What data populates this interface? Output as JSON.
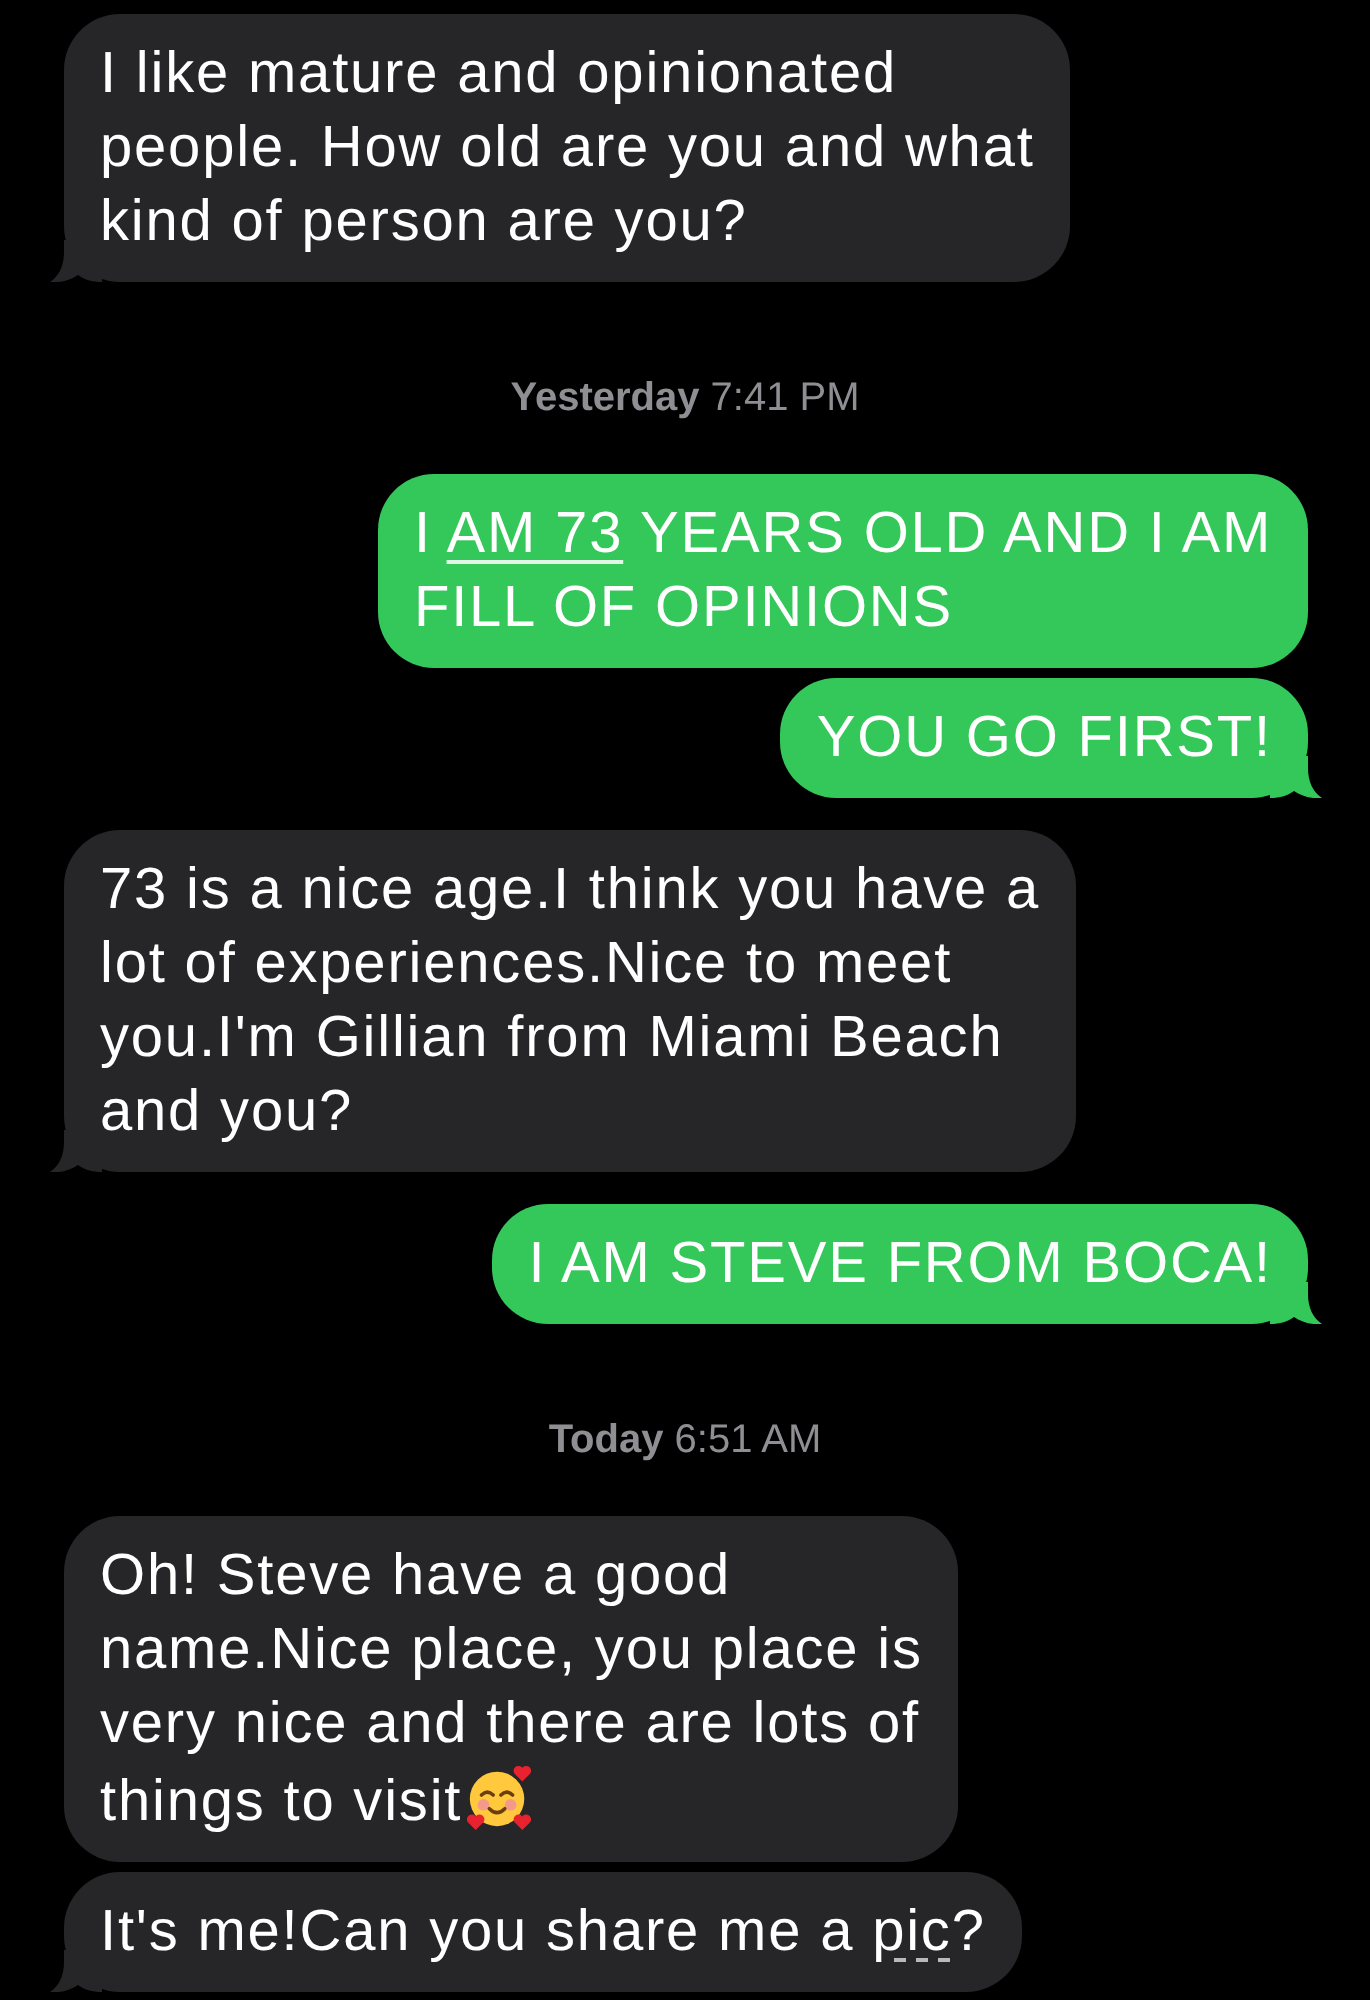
{
  "thread": [
    {
      "kind": "received",
      "tail": true,
      "lines": [
        [
          {
            "kind": "text",
            "text": "I like mature and opinionated"
          }
        ],
        [
          {
            "kind": "text",
            "text": "people. How old are you and what"
          }
        ],
        [
          {
            "kind": "text",
            "text": "kind of person are you?"
          }
        ]
      ]
    },
    {
      "kind": "timestamp",
      "text": "**Yesterday** 7:41 PM"
    },
    {
      "kind": "sent",
      "tail": false,
      "lines": [
        [
          {
            "kind": "text",
            "text": "I "
          },
          {
            "kind": "link",
            "text": "AM 73"
          },
          {
            "kind": "text",
            "text": " YEARS OLD AND I AM"
          }
        ],
        [
          {
            "kind": "text",
            "text": "FILL OF OPINIONS"
          }
        ]
      ]
    },
    {
      "kind": "sent",
      "tail": true,
      "lines": [
        [
          {
            "kind": "text",
            "text": "YOU GO FIRST!"
          }
        ]
      ]
    },
    {
      "kind": "received",
      "tail": true,
      "lines": [
        [
          {
            "kind": "text",
            "text": "73 is a nice age.I think you have a"
          }
        ],
        [
          {
            "kind": "text",
            "text": "lot of experiences.Nice to meet"
          }
        ],
        [
          {
            "kind": "text",
            "text": "you.I'm Gillian from Miami Beach"
          }
        ],
        [
          {
            "kind": "text",
            "text": "and you?"
          }
        ]
      ]
    },
    {
      "kind": "sent",
      "tail": true,
      "lines": [
        [
          {
            "kind": "text",
            "text": "I AM STEVE FROM BOCA!"
          }
        ]
      ]
    },
    {
      "kind": "timestamp",
      "text": "**Today** 6:51 AM"
    },
    {
      "kind": "received",
      "tail": false,
      "lines": [
        [
          {
            "kind": "text",
            "text": "Oh! Steve have a good"
          }
        ],
        [
          {
            "kind": "text",
            "text": "name.Nice place, you place is"
          }
        ],
        [
          {
            "kind": "text",
            "text": "very nice and there are lots of"
          }
        ],
        [
          {
            "kind": "text",
            "text": "things to visit"
          },
          {
            "kind": "emoji"
          }
        ]
      ]
    },
    {
      "kind": "received",
      "tail": true,
      "lines": [
        [
          {
            "kind": "text",
            "text": "It's me!Can you share me a "
          },
          {
            "kind": "lookup",
            "text": "pic"
          },
          {
            "kind": "text",
            "text": "?"
          }
        ]
      ]
    }
  ]
}
